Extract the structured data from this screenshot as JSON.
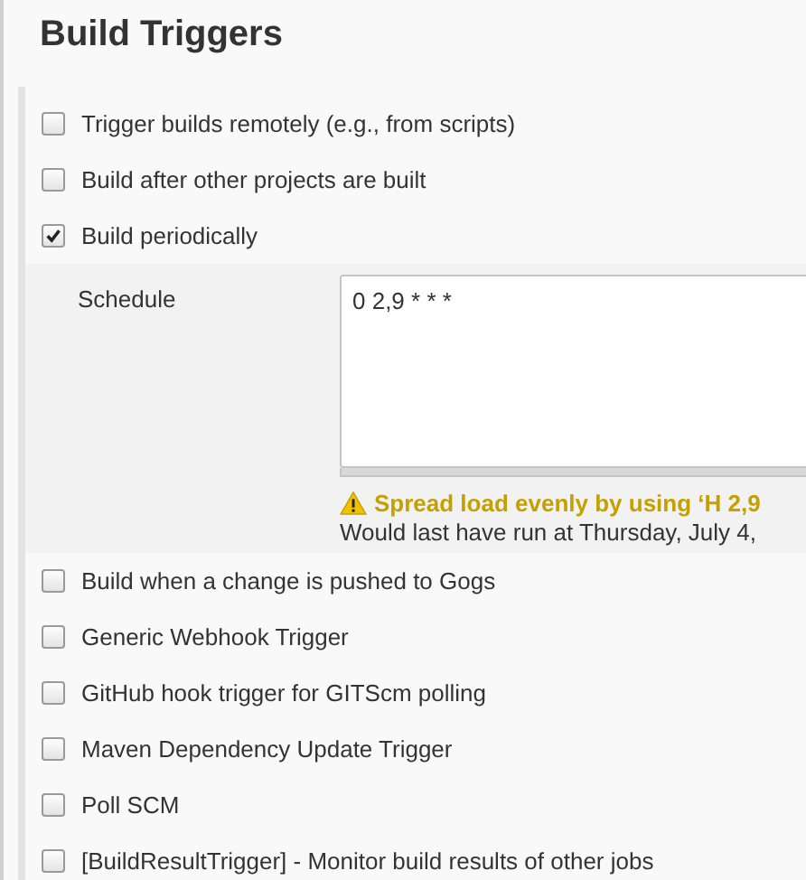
{
  "section": {
    "title": "Build Triggers"
  },
  "triggers": [
    {
      "label": "Trigger builds remotely (e.g., from scripts)",
      "checked": false
    },
    {
      "label": "Build after other projects are built",
      "checked": false
    },
    {
      "label": "Build periodically",
      "checked": true,
      "schedule": {
        "label": "Schedule",
        "value": "0 2,9 * * *",
        "warning": "Spread load evenly by using ‘H 2,9",
        "info": "Would last have run at Thursday, July 4,"
      }
    },
    {
      "label": "Build when a change is pushed to Gogs",
      "checked": false
    },
    {
      "label": "Generic Webhook Trigger",
      "checked": false
    },
    {
      "label": "GitHub hook trigger for GITScm polling",
      "checked": false
    },
    {
      "label": "Maven Dependency Update Trigger",
      "checked": false
    },
    {
      "label": "Poll SCM",
      "checked": false
    },
    {
      "label": "[BuildResultTrigger] - Monitor build results of other jobs",
      "checked": false
    }
  ]
}
